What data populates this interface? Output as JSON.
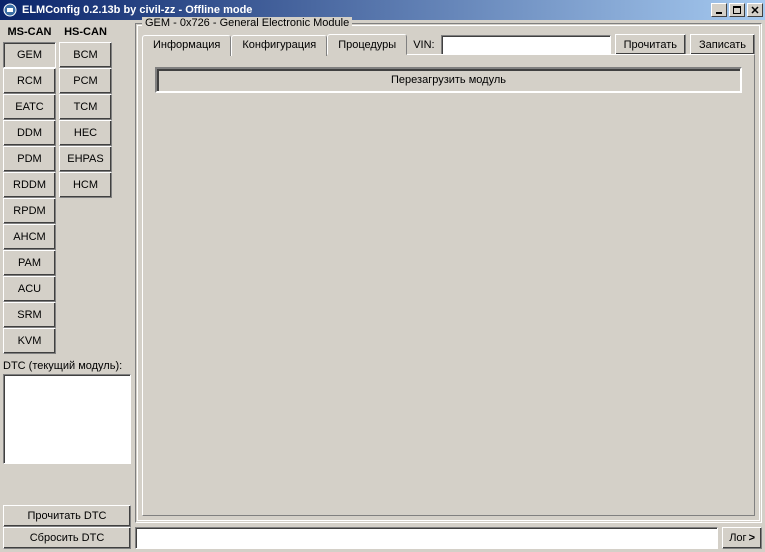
{
  "window": {
    "title": "ELMConfig 0.2.13b by civil-zz - Offline mode"
  },
  "can": {
    "ms_label": "MS-CAN",
    "hs_label": "HS-CAN",
    "ms_modules": [
      "GEM",
      "RCM",
      "EATC",
      "DDM",
      "PDM",
      "RDDM",
      "RPDM",
      "AHCM",
      "PAM",
      "ACU",
      "SRM",
      "KVM"
    ],
    "hs_modules": [
      "BCM",
      "PCM",
      "TCM",
      "HEC",
      "EHPAS",
      "HCM"
    ],
    "selected": "GEM"
  },
  "dtc": {
    "label": "DTC (текущий модуль):",
    "read_btn": "Прочитать DTC",
    "reset_btn": "Сбросить DTC"
  },
  "main": {
    "group_title": "GEM - 0x726 - General Electronic Module",
    "tabs": {
      "info": "Информация",
      "config": "Конфигурация",
      "proc": "Процедуры"
    },
    "active_tab": "proc",
    "vin_label": "VIN:",
    "vin_value": "",
    "read_btn": "Прочитать",
    "write_btn": "Записать",
    "reload_btn": "Перезагрузить модуль"
  },
  "status": {
    "text": "",
    "log_btn": "Лог",
    "log_arrow": ">"
  }
}
